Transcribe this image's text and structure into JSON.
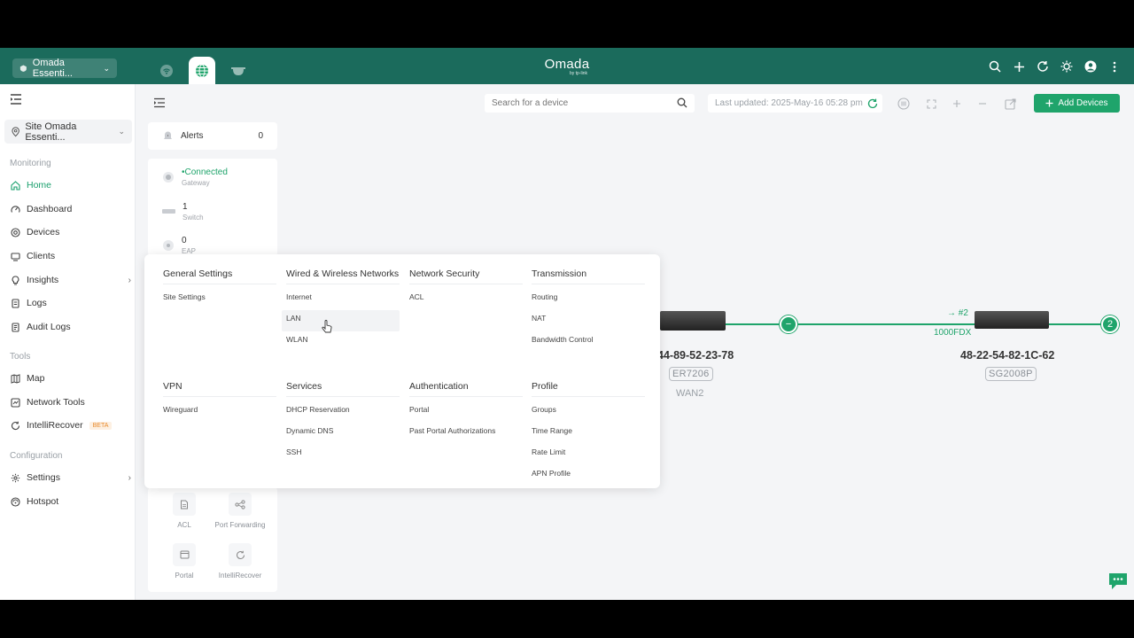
{
  "header": {
    "site_switch_label": "Omada Essenti...",
    "brand": "Omada",
    "brand_sub": "by tp-link"
  },
  "sidebar": {
    "site_select": "Site Omada Essenti...",
    "sections": {
      "monitoring": "Monitoring",
      "tools": "Tools",
      "configuration": "Configuration"
    },
    "items": [
      {
        "label": "Home",
        "icon": "home-icon",
        "active": true
      },
      {
        "label": "Dashboard",
        "icon": "dashboard-icon"
      },
      {
        "label": "Devices",
        "icon": "devices-icon"
      },
      {
        "label": "Clients",
        "icon": "clients-icon"
      },
      {
        "label": "Insights",
        "icon": "insights-icon"
      },
      {
        "label": "Logs",
        "icon": "logs-icon"
      },
      {
        "label": "Audit Logs",
        "icon": "audit-logs-icon"
      },
      {
        "label": "Map",
        "icon": "map-icon"
      },
      {
        "label": "Network Tools",
        "icon": "network-tools-icon"
      },
      {
        "label": "IntelliRecover",
        "icon": "intellirecover-icon",
        "badge": "BETA"
      },
      {
        "label": "Settings",
        "icon": "settings-icon"
      },
      {
        "label": "Hotspot",
        "icon": "hotspot-icon"
      }
    ]
  },
  "toolbar": {
    "search_placeholder": "Search for a device",
    "last_updated": "Last updated: 2025-May-16 05:28 pm",
    "add_devices": "Add Devices"
  },
  "panel": {
    "alerts_label": "Alerts",
    "alerts_count": "0",
    "gateway_status": "Connected",
    "gateway_label": "Gateway",
    "switch_count": "1",
    "switch_label": "Switch",
    "eap_count": "0",
    "eap_label": "EAP",
    "quick_actions": [
      "ACL",
      "Port Forwarding",
      "Portal",
      "IntelliRecover"
    ]
  },
  "topology": {
    "gateway_mac": "44-89-52-23-78",
    "gateway_model": "ER7206",
    "gateway_port": "WAN2",
    "switch_mac": "48-22-54-82-1C-62",
    "switch_model": "SG2008P",
    "link_port": "→ #2",
    "link_speed": "1000FDX",
    "end_count": "2"
  },
  "menu": {
    "columns": [
      {
        "heading": "General Settings",
        "items": [
          "Site Settings"
        ]
      },
      {
        "heading": "Wired & Wireless Networks",
        "items": [
          "Internet",
          "LAN",
          "WLAN"
        ]
      },
      {
        "heading": "Network Security",
        "items": [
          "ACL"
        ]
      },
      {
        "heading": "Transmission",
        "items": [
          "Routing",
          "NAT",
          "Bandwidth Control"
        ]
      },
      {
        "heading": "VPN",
        "items": [
          "Wireguard"
        ]
      },
      {
        "heading": "Services",
        "items": [
          "DHCP Reservation",
          "Dynamic DNS",
          "SSH"
        ]
      },
      {
        "heading": "Authentication",
        "items": [
          "Portal",
          "Past Portal Authorizations"
        ]
      },
      {
        "heading": "Profile",
        "items": [
          "Groups",
          "Time Range",
          "Rate Limit",
          "APN Profile"
        ]
      }
    ],
    "hovered_item": "LAN"
  },
  "colors": {
    "header_bg": "#1b6b5c",
    "accent": "#1fa46b"
  }
}
